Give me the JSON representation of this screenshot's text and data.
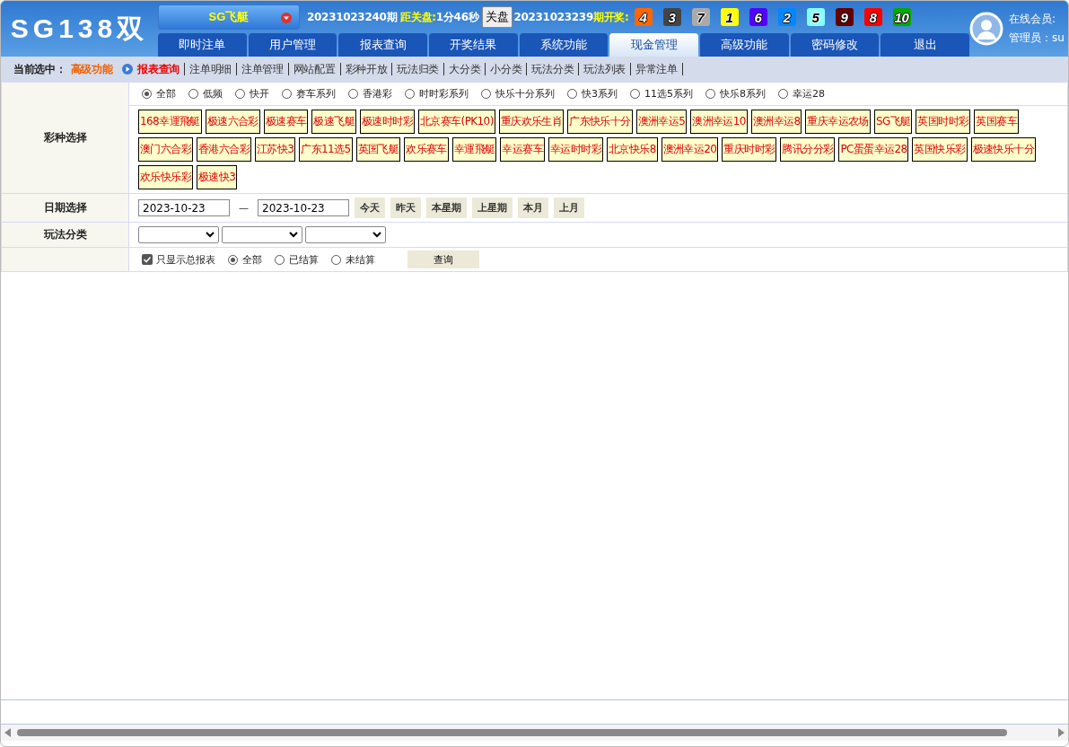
{
  "logo": "SG138双",
  "game_select": "SG飞艇",
  "current_issue": "20231023240期",
  "close_label": "距关盘:",
  "countdown": "1分46秒",
  "close_button": "关盘",
  "last_issue": "20231023239",
  "draw_label": "期开奖:",
  "balls": [
    {
      "number": "4",
      "color": "#ff6600"
    },
    {
      "number": "3",
      "color": "#444444"
    },
    {
      "number": "7",
      "color": "#aaaaaa"
    },
    {
      "number": "1",
      "color": "#ffff00"
    },
    {
      "number": "6",
      "color": "#5500ff"
    },
    {
      "number": "2",
      "color": "#0088ff"
    },
    {
      "number": "5",
      "color": "#88ffff"
    },
    {
      "number": "9",
      "color": "#660000"
    },
    {
      "number": "8",
      "color": "#ff0000"
    },
    {
      "number": "10",
      "color": "#00aa00"
    }
  ],
  "user": {
    "online": "在线会员:",
    "admin": "管理员：su"
  },
  "tabs": [
    {
      "label": "即时注单",
      "selected": false
    },
    {
      "label": "用户管理",
      "selected": false
    },
    {
      "label": "报表查询",
      "selected": false
    },
    {
      "label": "开奖结果",
      "selected": false
    },
    {
      "label": "系统功能",
      "selected": false
    },
    {
      "label": "现金管理",
      "selected": true
    },
    {
      "label": "高级功能",
      "selected": false
    },
    {
      "label": "密码修改",
      "selected": false
    },
    {
      "label": "退出",
      "selected": false
    }
  ],
  "breadcrumb": {
    "label": "当前选中：",
    "section": "高级功能"
  },
  "subnav": [
    {
      "label": "报表查询",
      "selected": true
    },
    {
      "label": "注单明细",
      "selected": false
    },
    {
      "label": "注单管理",
      "selected": false
    },
    {
      "label": "网站配置",
      "selected": false
    },
    {
      "label": "彩种开放",
      "selected": false
    },
    {
      "label": "玩法归类",
      "selected": false
    },
    {
      "label": "大分类",
      "selected": false
    },
    {
      "label": "小分类",
      "selected": false
    },
    {
      "label": "玩法分类",
      "selected": false
    },
    {
      "label": "玩法列表",
      "selected": false
    },
    {
      "label": "异常注单",
      "selected": false
    }
  ],
  "lottery": {
    "label": "彩种选择",
    "filters": [
      {
        "label": "全部",
        "selected": true
      },
      {
        "label": "低频",
        "selected": false
      },
      {
        "label": "快开",
        "selected": false
      },
      {
        "label": "赛车系列",
        "selected": false
      },
      {
        "label": "香港彩",
        "selected": false
      },
      {
        "label": "时时彩系列",
        "selected": false
      },
      {
        "label": "快乐十分系列",
        "selected": false
      },
      {
        "label": "快3系列",
        "selected": false
      },
      {
        "label": "11选5系列",
        "selected": false
      },
      {
        "label": "快乐8系列",
        "selected": false
      },
      {
        "label": "幸运28",
        "selected": false
      }
    ],
    "games": [
      "168幸運飛艇",
      "极速六合彩",
      "极速赛车",
      "极速飞艇",
      "极速时时彩",
      "北京赛车(PK10)",
      "重庆欢乐生肖",
      "广东快乐十分",
      "澳洲幸运5",
      "澳洲幸运10",
      "澳洲幸运8",
      "重庆幸运农场",
      "SG飞艇",
      "英国时时彩",
      "英国赛车",
      "澳门六合彩",
      "香港六合彩",
      "江苏快3",
      "广东11选5",
      "英国飞艇",
      "欢乐赛车",
      "幸運飛艇",
      "幸运赛车",
      "幸运时时彩",
      "北京快乐8",
      "澳洲幸运20",
      "重庆时时彩",
      "腾讯分分彩",
      "PC蛋蛋幸运28",
      "英国快乐彩",
      "极速快乐十分",
      "欢乐快乐彩",
      "极速快3"
    ]
  },
  "date": {
    "label": "日期选择",
    "from": "2023-10-23",
    "separator": "—",
    "to": "2023-10-23",
    "quick": [
      "今天",
      "昨天",
      "本星期",
      "上星期",
      "本月",
      "上月"
    ]
  },
  "play": {
    "label": "玩法分类"
  },
  "options": {
    "summary_only": {
      "label": "只显示总报表",
      "checked": true
    },
    "status": [
      {
        "label": "全部",
        "selected": true
      },
      {
        "label": "已结算",
        "selected": false
      },
      {
        "label": "未结算",
        "selected": false
      }
    ],
    "query": "查询"
  }
}
